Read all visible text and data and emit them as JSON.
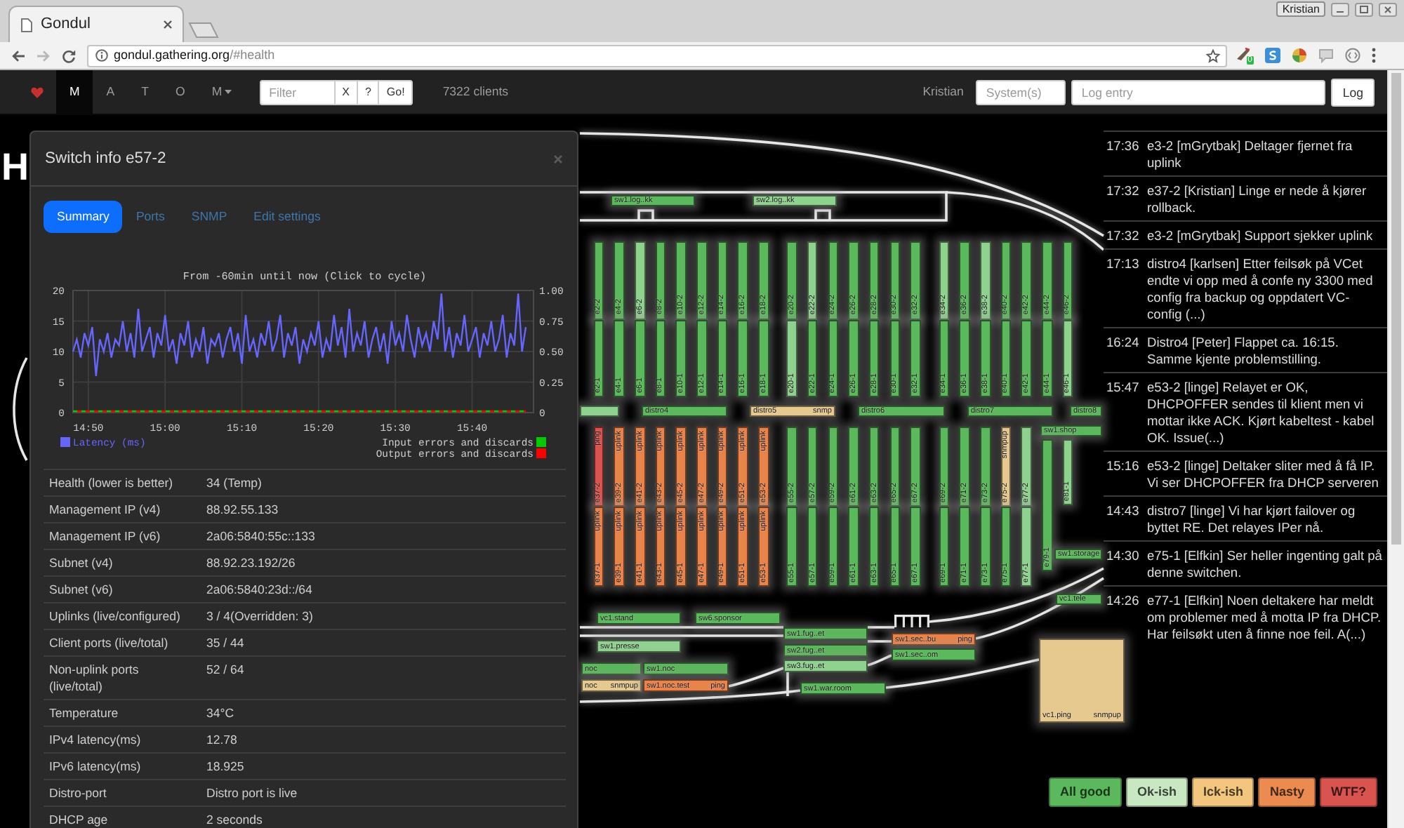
{
  "browser": {
    "tab_title": "Gondul",
    "profile": "Kristian",
    "url_host": "gondul.gathering.org",
    "url_path": "/#health",
    "extension_badge": "0"
  },
  "navbar": {
    "items": [
      {
        "label": "M",
        "selected": true,
        "dropdown": false
      },
      {
        "label": "A",
        "selected": false,
        "dropdown": false
      },
      {
        "label": "T",
        "selected": false,
        "dropdown": false
      },
      {
        "label": "O",
        "selected": false,
        "dropdown": false
      },
      {
        "label": "M",
        "selected": false,
        "dropdown": true
      }
    ],
    "filter": {
      "placeholder": "Filter"
    },
    "filter_buttons": [
      "X",
      "?",
      "Go!"
    ],
    "client_count": "7322 clients",
    "user": "Kristian",
    "systems_field": {
      "placeholder": "System(s)"
    },
    "log_field": {
      "placeholder": "Log entry"
    },
    "log_button": "Log"
  },
  "map": {
    "heading": "H",
    "top_row": [
      [
        {
          "segments": [
            {
              "name": "e2-2",
              "color": "#5cb85c"
            },
            {
              "name": "e2-1",
              "color": "#5cb85c"
            }
          ]
        },
        {
          "segments": [
            {
              "name": "e4-2",
              "color": "#5cb85c"
            },
            {
              "name": "e4-1",
              "color": "#5cb85c"
            }
          ]
        },
        {
          "segments": [
            {
              "name": "e6-2",
              "color": "#8fd18f"
            },
            {
              "name": "e6-1",
              "color": "#5cb85c"
            }
          ]
        },
        {
          "segments": [
            {
              "name": "e8-2",
              "color": "#5cb85c"
            },
            {
              "name": "e8-1",
              "color": "#5cb85c"
            }
          ]
        },
        {
          "segments": [
            {
              "name": "e10-2",
              "color": "#5cb85c"
            },
            {
              "name": "e10-1",
              "color": "#5cb85c"
            }
          ]
        },
        {
          "segments": [
            {
              "name": "e12-2",
              "color": "#5cb85c"
            },
            {
              "name": "e12-1",
              "color": "#5cb85c"
            }
          ]
        },
        {
          "segments": [
            {
              "name": "e14-2",
              "color": "#5cb85c"
            },
            {
              "name": "e14-1",
              "color": "#5cb85c"
            }
          ]
        },
        {
          "segments": [
            {
              "name": "e16-2",
              "color": "#5cb85c"
            },
            {
              "name": "e16-1",
              "color": "#5cb85c"
            }
          ]
        },
        {
          "segments": [
            {
              "name": "e18-2",
              "color": "#5cb85c"
            },
            {
              "name": "e18-1",
              "color": "#5cb85c"
            }
          ]
        }
      ],
      [
        {
          "segments": [
            {
              "name": "e20-2",
              "color": "#5cb85c"
            },
            {
              "name": "e20-1",
              "color": "#8fd18f"
            }
          ]
        },
        {
          "segments": [
            {
              "name": "e22-2",
              "color": "#8fd18f"
            },
            {
              "name": "e22-1",
              "color": "#5cb85c"
            }
          ]
        },
        {
          "segments": [
            {
              "name": "e24-2",
              "color": "#5cb85c"
            },
            {
              "name": "e24-1",
              "color": "#5cb85c"
            }
          ]
        },
        {
          "segments": [
            {
              "name": "e26-2",
              "color": "#5cb85c"
            },
            {
              "name": "e26-1",
              "color": "#5cb85c"
            }
          ]
        },
        {
          "segments": [
            {
              "name": "e28-2",
              "color": "#5cb85c"
            },
            {
              "name": "e28-1",
              "color": "#5cb85c"
            }
          ]
        },
        {
          "segments": [
            {
              "name": "e30-2",
              "color": "#5cb85c"
            },
            {
              "name": "e30-1",
              "color": "#5cb85c"
            }
          ]
        },
        {
          "segments": [
            {
              "name": "e32-2",
              "color": "#5cb85c"
            },
            {
              "name": "e32-1",
              "color": "#5cb85c"
            }
          ]
        }
      ],
      [
        {
          "segments": [
            {
              "name": "e34-2",
              "color": "#8fd18f"
            },
            {
              "name": "e34-1",
              "color": "#5cb85c"
            }
          ]
        },
        {
          "segments": [
            {
              "name": "e36-2",
              "color": "#5cb85c"
            },
            {
              "name": "e36-1",
              "color": "#5cb85c"
            }
          ]
        },
        {
          "segments": [
            {
              "name": "e38-2",
              "color": "#8fd18f"
            },
            {
              "name": "e38-1",
              "color": "#5cb85c"
            }
          ]
        },
        {
          "segments": [
            {
              "name": "e40-2",
              "color": "#5cb85c"
            },
            {
              "name": "e40-1",
              "color": "#5cb85c"
            }
          ]
        },
        {
          "segments": [
            {
              "name": "e42-2",
              "color": "#5cb85c"
            },
            {
              "name": "e42-1",
              "color": "#5cb85c"
            }
          ]
        },
        {
          "segments": [
            {
              "name": "e44-2",
              "color": "#5cb85c"
            },
            {
              "name": "e44-1",
              "color": "#5cb85c"
            }
          ]
        },
        {
          "segments": [
            {
              "name": "e46-2",
              "color": "#5cb85c"
            },
            {
              "name": "e46-1",
              "color": "#8fd18f"
            }
          ]
        }
      ]
    ],
    "distros": [
      {
        "color": "#8fd18f"
      },
      {
        "name": "distro4",
        "color": "#5cb85c"
      },
      {
        "name": "distro5",
        "status": "snmp",
        "color": "#e6c98e"
      },
      {
        "name": "distro6",
        "color": "#5cb85c"
      },
      {
        "name": "distro7",
        "color": "#5cb85c"
      },
      {
        "name": "distro8",
        "color": "#5cb85c"
      }
    ],
    "bottom_row": [
      [
        {
          "segments": [
            {
              "status": "ping",
              "name": "e37-2",
              "color": "#d9534f"
            },
            {
              "status": "uplink",
              "name": "e37-1",
              "color": "#e8834a"
            }
          ]
        },
        {
          "segments": [
            {
              "status": "uplink",
              "name": "e39-2",
              "color": "#e8834a"
            },
            {
              "status": "uplink",
              "name": "e39-1",
              "color": "#e8834a"
            }
          ]
        },
        {
          "segments": [
            {
              "status": "uplink",
              "name": "e41-2",
              "color": "#e8834a"
            },
            {
              "status": "uplink",
              "name": "e41-1",
              "color": "#e8834a"
            }
          ]
        },
        {
          "segments": [
            {
              "status": "uplink",
              "name": "e43-2",
              "color": "#e8834a"
            },
            {
              "status": "uplink",
              "name": "e43-1",
              "color": "#e8834a"
            }
          ]
        },
        {
          "segments": [
            {
              "status": "uplink",
              "name": "e45-2",
              "color": "#e8834a"
            },
            {
              "status": "uplink",
              "name": "e45-1",
              "color": "#e8834a"
            }
          ]
        },
        {
          "segments": [
            {
              "status": "uplink",
              "name": "e47-2",
              "color": "#e8834a"
            },
            {
              "status": "uplink",
              "name": "e47-1",
              "color": "#e8834a"
            }
          ]
        },
        {
          "segments": [
            {
              "status": "uplink",
              "name": "e49-2",
              "color": "#e8834a"
            },
            {
              "status": "uplink",
              "name": "e49-1",
              "color": "#e8834a"
            }
          ]
        },
        {
          "segments": [
            {
              "status": "uplink",
              "name": "e51-2",
              "color": "#e8834a"
            },
            {
              "status": "uplink",
              "name": "e51-1",
              "color": "#e8834a"
            }
          ]
        },
        {
          "segments": [
            {
              "status": "uplink",
              "name": "e53-2",
              "color": "#e8834a"
            },
            {
              "status": "uplink",
              "name": "e53-1",
              "color": "#e8834a"
            }
          ]
        }
      ],
      [
        {
          "segments": [
            {
              "name": "e55-2",
              "color": "#5cb85c"
            },
            {
              "name": "e55-1",
              "color": "#5cb85c"
            }
          ]
        },
        {
          "segments": [
            {
              "name": "e57-2",
              "color": "#5cb85c"
            },
            {
              "name": "e57-1",
              "color": "#5cb85c"
            }
          ]
        },
        {
          "segments": [
            {
              "name": "e59-2",
              "color": "#5cb85c"
            },
            {
              "name": "e59-1",
              "color": "#5cb85c"
            }
          ]
        },
        {
          "segments": [
            {
              "name": "e61-2",
              "color": "#5cb85c"
            },
            {
              "name": "e61-1",
              "color": "#5cb85c"
            }
          ]
        },
        {
          "segments": [
            {
              "name": "e63-2",
              "color": "#5cb85c"
            },
            {
              "name": "e63-1",
              "color": "#5cb85c"
            }
          ]
        },
        {
          "segments": [
            {
              "name": "e65-2",
              "color": "#5cb85c"
            },
            {
              "name": "e65-1",
              "color": "#5cb85c"
            }
          ]
        },
        {
          "segments": [
            {
              "name": "e67-2",
              "color": "#5cb85c"
            },
            {
              "name": "e67-1",
              "color": "#5cb85c"
            }
          ]
        }
      ],
      [
        {
          "segments": [
            {
              "name": "e69-2",
              "color": "#5cb85c"
            },
            {
              "name": "e69-1",
              "color": "#5cb85c"
            }
          ]
        },
        {
          "segments": [
            {
              "name": "e71-2",
              "color": "#5cb85c"
            },
            {
              "name": "e71-1",
              "color": "#5cb85c"
            }
          ]
        },
        {
          "segments": [
            {
              "name": "e73-2",
              "color": "#5cb85c"
            },
            {
              "name": "e73-1",
              "color": "#5cb85c"
            }
          ]
        },
        {
          "segments": [
            {
              "status": "snmpup",
              "name": "e75-2",
              "color": "#e6c98e"
            },
            {
              "name": "e75-1",
              "color": "#5cb85c"
            }
          ]
        },
        {
          "segments": [
            {
              "name": "e77-2",
              "color": "#8fd18f"
            },
            {
              "name": "e77-1",
              "color": "#8fd18f"
            }
          ]
        }
      ]
    ],
    "shop": {
      "name": "sw1.shop",
      "color": "#5cb85c",
      "columns": [
        {
          "segments": [
            {
              "name": "e79-1",
              "color": "#5cb85c"
            }
          ]
        },
        {
          "segments": [
            {
              "name": "e81-1",
              "color": "#8fd18f"
            }
          ]
        }
      ]
    },
    "switches": [
      {
        "name": "sw1.log..kk",
        "color": "#5cb85c"
      },
      {
        "name": "sw2.log..kk",
        "color": "#8fd18f"
      },
      {
        "name": "sw1.storage",
        "color": "#5cb85c"
      },
      {
        "name": "vc1.tele",
        "color": "#5cb85c"
      },
      {
        "name": "vc1.stand",
        "color": "#5cb85c"
      },
      {
        "name": "sw6.sponsor",
        "color": "#5cb85c"
      },
      {
        "name": "sw1.presse",
        "color": "#8fd18f"
      },
      {
        "name": "sw1.fug..et",
        "color": "#5cb85c"
      },
      {
        "name": "sw2.fug..et",
        "color": "#5cb85c"
      },
      {
        "name": "sw3.fug..et",
        "color": "#8fd18f"
      },
      {
        "name": "sw1.sec..bu",
        "status": "ping",
        "color": "#e8834a"
      },
      {
        "name": "sw1.sec..om",
        "color": "#5cb85c"
      },
      {
        "name": "noc",
        "color": "#5cb85c"
      },
      {
        "name": "sw1.noc",
        "color": "#5cb85c"
      },
      {
        "name": "noc",
        "status": "snmpup",
        "color": "#e6c98e"
      },
      {
        "name": "sw1.noc.test",
        "status": "ping",
        "color": "#e8834a"
      },
      {
        "name": "sw1.war.room",
        "color": "#5cb85c"
      },
      {
        "name": "vc1.ping",
        "status": "snmpup",
        "color": "#e6c98e"
      }
    ]
  },
  "switch_info": {
    "title": "Switch info e57-2",
    "tabs": [
      {
        "label": "Summary",
        "selected": true
      },
      {
        "label": "Ports",
        "selected": false
      },
      {
        "label": "SNMP",
        "selected": false
      },
      {
        "label": "Edit settings",
        "selected": false
      }
    ],
    "chart_data": {
      "type": "line",
      "title": "From -60min until now (Click to cycle)",
      "grid": true,
      "legend": true,
      "categories": [
        null,
        null,
        null,
        null,
        "14:50",
        null,
        null,
        null,
        null,
        null,
        null,
        null,
        null,
        null,
        null,
        null,
        null,
        null,
        null,
        null,
        null,
        null,
        null,
        null,
        "15:00",
        null,
        null,
        null,
        null,
        null,
        null,
        null,
        null,
        null,
        null,
        null,
        null,
        null,
        null,
        null,
        null,
        null,
        null,
        null,
        "15:10",
        null,
        null,
        null,
        null,
        null,
        null,
        null,
        null,
        null,
        null,
        null,
        null,
        null,
        null,
        null,
        null,
        null,
        null,
        null,
        "15:20",
        null,
        null,
        null,
        null,
        null,
        null,
        null,
        null,
        null,
        null,
        null,
        null,
        null,
        null,
        null,
        null,
        null,
        null,
        null,
        "15:30",
        null,
        null,
        null,
        null,
        null,
        null,
        null,
        null,
        null,
        null,
        null,
        null,
        null,
        null,
        null,
        null,
        null,
        null,
        null,
        "15:40",
        null,
        null,
        null,
        null,
        null,
        null,
        null,
        null,
        null,
        null,
        null,
        null,
        null,
        null,
        null,
        null
      ],
      "ylim": [
        0,
        20
      ],
      "yticks": [
        {
          "value": 0,
          "label": "0"
        },
        {
          "value": 5,
          "label": "5"
        },
        {
          "value": 10,
          "label": "10"
        },
        {
          "value": 15,
          "label": "15"
        },
        {
          "value": 20,
          "label": "20"
        }
      ],
      "series": [
        {
          "name": "Latency (ms)",
          "color": "#6666ff",
          "values": [
            10,
            12,
            9,
            13,
            11,
            14,
            6,
            12,
            10,
            13,
            9,
            12,
            11,
            15,
            10,
            13,
            9,
            17,
            10,
            12,
            14,
            9,
            13,
            11,
            16,
            10,
            12,
            8,
            13,
            11,
            15,
            9,
            12,
            10,
            14,
            8,
            12,
            11,
            13,
            9,
            12,
            14,
            10,
            13,
            8,
            16,
            10,
            12,
            9,
            13,
            11,
            15,
            10,
            12,
            16,
            9,
            13,
            11,
            14,
            8,
            12,
            10,
            13,
            11,
            15,
            9,
            12,
            10,
            16,
            11,
            14,
            9,
            17,
            10,
            13,
            11,
            15,
            9,
            12,
            14,
            10,
            13,
            8,
            15,
            11,
            13,
            10,
            16,
            12,
            9,
            14,
            11,
            13,
            10,
            15,
            12,
            19.5,
            10,
            14,
            9,
            13,
            11,
            16,
            10,
            12,
            14,
            9,
            13,
            11,
            15,
            10,
            12,
            16,
            9,
            13,
            11,
            19.5,
            10,
            14,
            null,
            null
          ]
        },
        {
          "name": "Input errors and discards",
          "color": "#00cc00",
          "line_style": "dashed",
          "values": [
            0,
            0,
            0,
            0,
            0,
            0,
            0,
            0,
            0,
            0,
            0,
            0,
            0,
            0,
            0,
            0,
            0,
            0,
            0,
            0,
            0,
            0,
            0,
            0,
            0,
            0,
            0,
            0,
            0,
            0,
            0,
            0,
            0,
            0,
            0,
            0,
            0,
            0,
            0,
            0,
            0,
            0,
            0,
            0,
            0,
            0,
            0,
            0,
            0,
            0,
            0,
            0,
            0,
            0,
            0,
            0,
            0,
            0,
            0,
            0,
            0,
            0,
            0,
            0,
            0,
            0,
            0,
            0,
            0,
            0,
            0,
            0,
            0,
            0,
            0,
            0,
            0,
            0,
            0,
            0,
            0,
            0,
            0,
            0,
            0,
            0,
            0,
            0,
            0,
            0,
            0,
            0,
            0,
            0,
            0,
            0,
            0,
            0,
            0,
            0,
            0,
            0,
            0,
            0,
            0,
            0,
            0,
            0,
            0,
            0,
            0,
            0,
            0,
            0,
            0,
            0,
            0,
            0,
            0,
            null,
            null
          ]
        },
        {
          "name": "Output errors and discards",
          "color": "#ff0000",
          "line_style": "dashed",
          "values": [
            0,
            0,
            0,
            0,
            0,
            0,
            0,
            0,
            0,
            0,
            0,
            0,
            0,
            0,
            0,
            0,
            0,
            0,
            0,
            0,
            0,
            0,
            0,
            0,
            0,
            0,
            0,
            0,
            0,
            0,
            0,
            0,
            0,
            0,
            0,
            0,
            0,
            0,
            0,
            0,
            0,
            0,
            0,
            0,
            0,
            0,
            0,
            0,
            0,
            0,
            0,
            0,
            0,
            0,
            0,
            0,
            0,
            0,
            0,
            0,
            0,
            0,
            0,
            0,
            0,
            0,
            0,
            0,
            0,
            0,
            0,
            0,
            0,
            0,
            0,
            0,
            0,
            0,
            0,
            0,
            0,
            0,
            0,
            0,
            0,
            0,
            0,
            0,
            0,
            0,
            0,
            0,
            0,
            0,
            0,
            0,
            0,
            0,
            0,
            0,
            0,
            0,
            0,
            0,
            0,
            0,
            0,
            0,
            0,
            0,
            0,
            0,
            0,
            0,
            0,
            0,
            0,
            0,
            0,
            null,
            null
          ]
        }
      ]
    },
    "secondary_yticks": [
      "1.00",
      "0.75",
      "0.50",
      "0.25",
      "0"
    ],
    "rows": [
      {
        "label": "Health (lower is better)",
        "value": "34 (Temp)"
      },
      {
        "label": "Management IP (v4)",
        "value": "88.92.55.133"
      },
      {
        "label": "Management IP (v6)",
        "value": "2a06:5840:55c::133"
      },
      {
        "label": "Subnet (v4)",
        "value": "88.92.23.192/26"
      },
      {
        "label": "Subnet (v6)",
        "value": "2a06:5840:23d::/64"
      },
      {
        "label": "Uplinks (live/configured)",
        "value": "3 / 4(Overridden: 3)"
      },
      {
        "label": "Client ports (live/total)",
        "value": "35 / 44"
      },
      {
        "label": "Non-uplink ports (live/total)",
        "value": "52 / 64"
      },
      {
        "label": "Temperature",
        "value": "34°C"
      },
      {
        "label": "IPv4 latency(ms)",
        "value": "12.78"
      },
      {
        "label": "IPv6 latency(ms)",
        "value": "18.925"
      },
      {
        "label": "Distro-port",
        "value": "Distro port is live"
      },
      {
        "label": "DHCP age",
        "value": "2 seconds"
      }
    ]
  },
  "log": [
    {
      "time": "17:36",
      "text": "e3-2 [mGrytbak] Deltager fjernet fra uplink"
    },
    {
      "time": "17:32",
      "text": "e37-2 [Kristian] Linge er nede å kjører rollback."
    },
    {
      "time": "17:32",
      "text": "e3-2 [mGrytbak] Support sjekker uplink"
    },
    {
      "time": "17:13",
      "text": "distro4 [karlsen] Etter feilsøk på VCet endte vi opp med å confe ny 3300 med config fra backup og oppdatert VC-config (...)"
    },
    {
      "time": "16:24",
      "text": "Distro4 [Peter] Flappet ca. 16:15. Samme kjente problemstilling."
    },
    {
      "time": "15:47",
      "text": "e53-2 [linge] Relayet er OK, DHCPOFFER sendes til klient men vi mottar ikke ACK. Kjørt kabeltest - kabel OK. Issue(...)"
    },
    {
      "time": "15:16",
      "text": "e53-2 [linge] Deltaker sliter med å få IP. Vi ser DHCPOFFER fra DHCP serveren"
    },
    {
      "time": "14:43",
      "text": "distro7 [linge] Vi har kjørt failover og byttet RE. Det relayes IPer nå."
    },
    {
      "time": "14:30",
      "text": "e75-1 [Elfkin] Ser heller ingenting galt på denne switchen."
    },
    {
      "time": "14:26",
      "text": "e77-1 [Elfkin] Noen deltakere har meldt om problemer med å motta IP fra DHCP. Har feilsøkt uten å finne noe feil. A(...)"
    }
  ],
  "legend": [
    {
      "label": "All good",
      "color": "#5cb85c"
    },
    {
      "label": "Ok-ish",
      "color": "#c8e8c1"
    },
    {
      "label": "Ick-ish",
      "color": "#f2c67e"
    },
    {
      "label": "Nasty",
      "color": "#eb8b50"
    },
    {
      "label": "WTF?",
      "color": "#d9534f"
    }
  ]
}
